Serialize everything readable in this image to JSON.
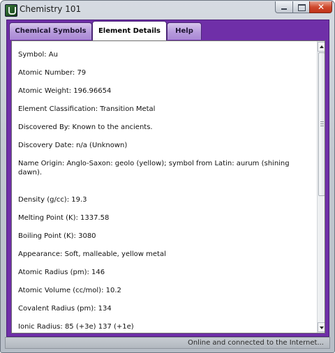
{
  "window": {
    "title": "Chemistry 101",
    "icon": "flask-icon",
    "controls": {
      "minimize": "minimize-icon",
      "maximize": "maximize-icon",
      "close": "close-icon"
    }
  },
  "tabs": [
    {
      "label": "Chemical Symbols",
      "selected": false
    },
    {
      "label": "Element Details",
      "selected": true
    },
    {
      "label": "Help",
      "selected": false
    }
  ],
  "details": [
    "Symbol: Au",
    "Atomic Number: 79",
    "Atomic Weight: 196.96654",
    "Element Classification: Transition Metal",
    "Discovered By: Known to the ancients.",
    "Discovery Date: n/a (Unknown)",
    "Name Origin: Anglo-Saxon: geolo (yellow); symbol from Latin: aurum (shining dawn).",
    "Density (g/cc): 19.3",
    "Melting Point (K): 1337.58",
    "Boiling Point (K): 3080",
    "Appearance: Soft, malleable, yellow metal",
    "Atomic Radius (pm): 146",
    "Atomic Volume (cc/mol): 10.2",
    "Covalent Radius (pm): 134",
    "Ionic Radius: 85 (+3e) 137 (+1e)"
  ],
  "status": "Online and connected to the Internet...",
  "colors": {
    "panel": "#6f2fa8",
    "tab_inactive": "#b79bdc",
    "close_button": "#cf4a2e"
  }
}
